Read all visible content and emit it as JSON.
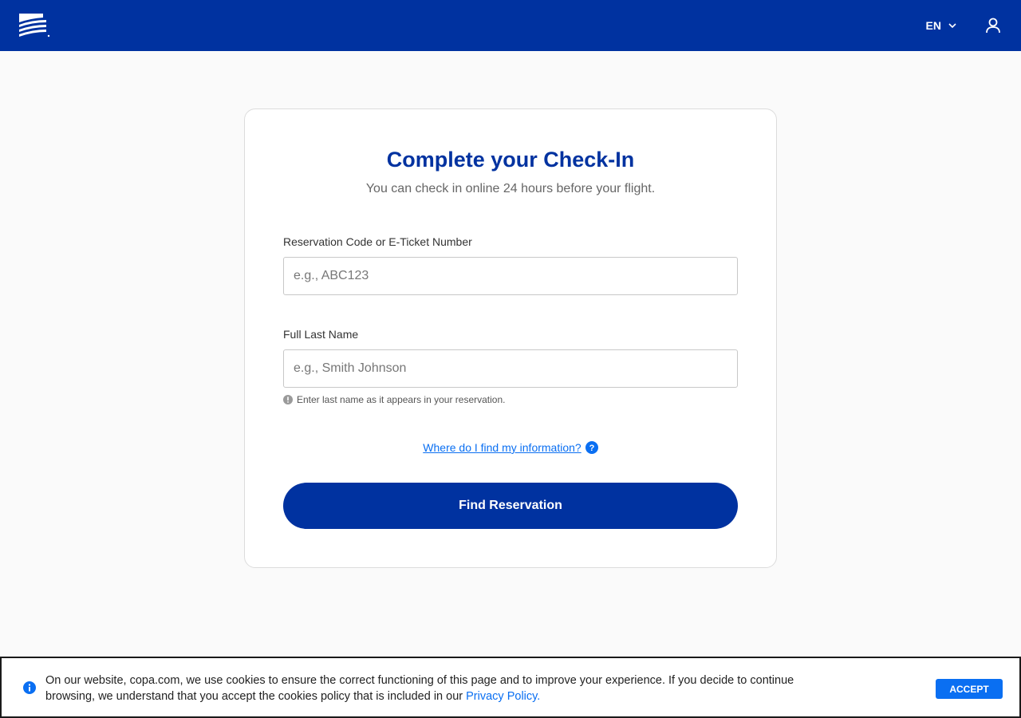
{
  "header": {
    "language": "EN",
    "brand_color": "#0032a0"
  },
  "form": {
    "title": "Complete your Check-In",
    "subtitle": "You can check in online 24 hours before your flight.",
    "reservation_label": "Reservation Code or E-Ticket Number",
    "reservation_placeholder": "e.g., ABC123",
    "reservation_value": "",
    "lastname_label": "Full Last Name",
    "lastname_placeholder": "e.g., Smith Johnson",
    "lastname_value": "",
    "lastname_hint": "Enter last name as it appears in your reservation.",
    "help_link": "Where do I find my information?",
    "submit_label": "Find Reservation"
  },
  "cookie_banner": {
    "text": "On our website, copa.com, we use cookies to ensure the correct functioning of this page and to improve your experience. If you decide to continue browsing, we understand that you accept the cookies policy that is included in our ",
    "link": "Privacy Policy.",
    "accept_label": "ACCEPT",
    "accent_color": "#0a6ff2"
  },
  "icons": {
    "logo": "copa-logo-icon",
    "language": "chevron-down-icon",
    "account": "user-icon",
    "hint": "info-circle-icon",
    "help": "question-circle-icon",
    "cookie": "info-icon"
  }
}
